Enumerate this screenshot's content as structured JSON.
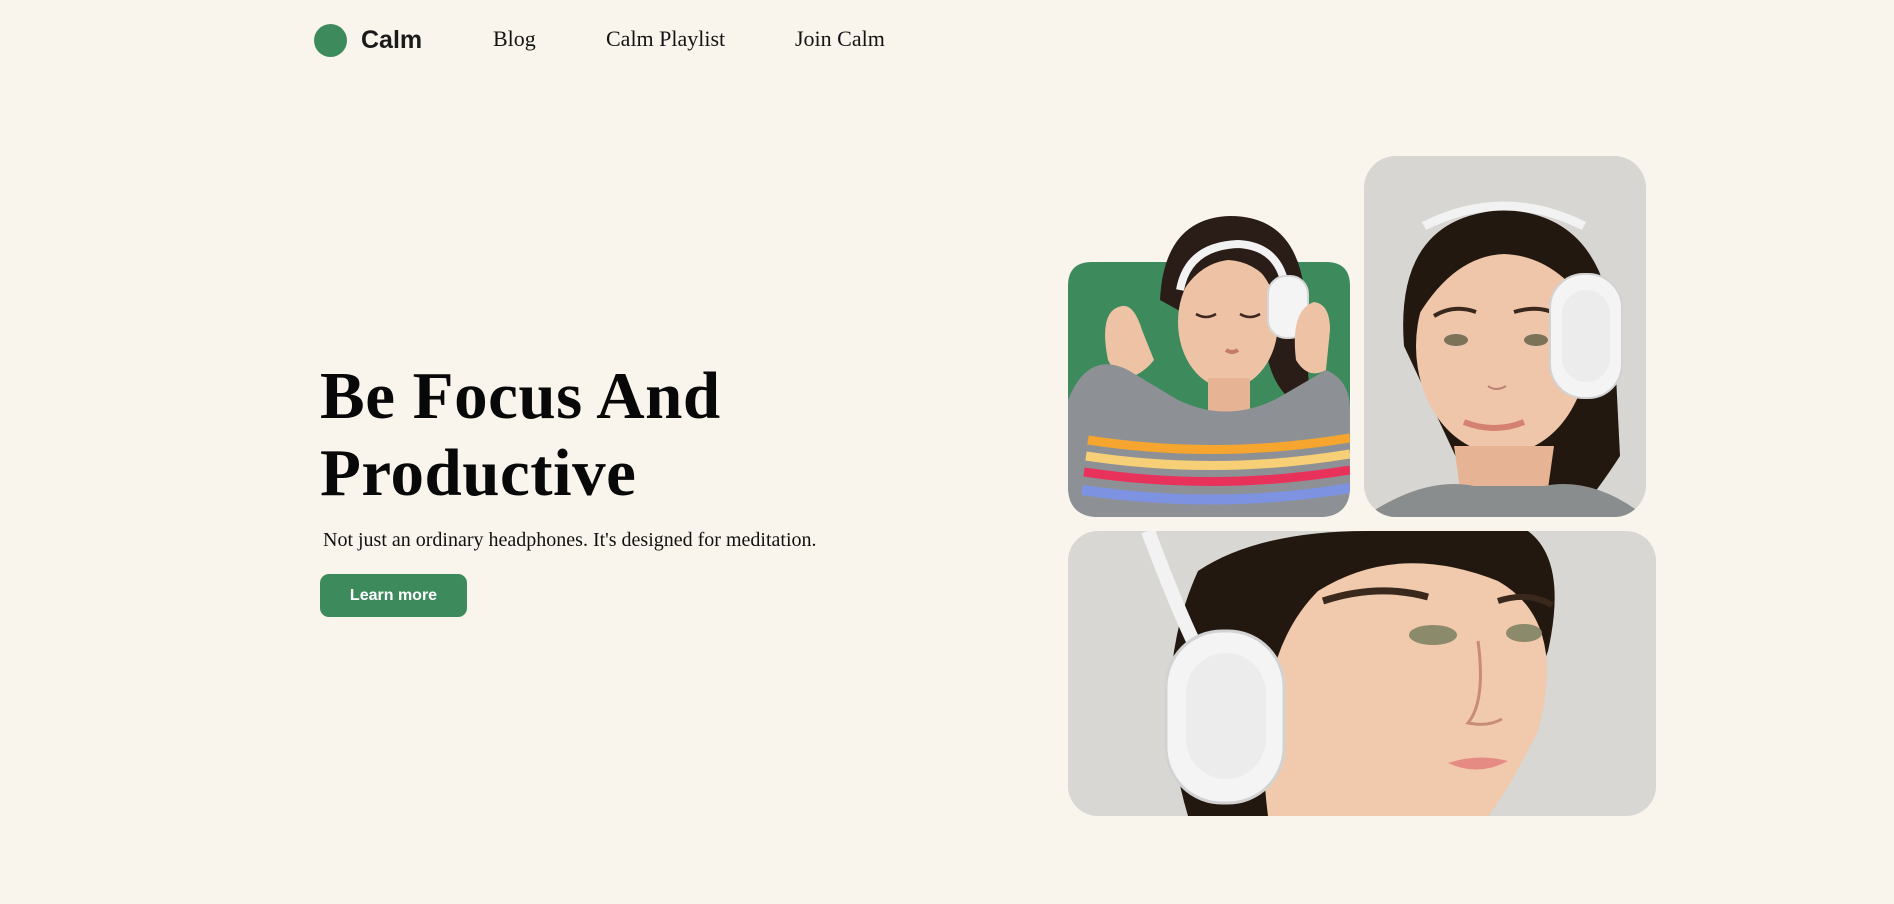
{
  "brand": {
    "name": "Calm",
    "accent_color": "#3d8a5c",
    "background_color": "#f9f4ec"
  },
  "nav": {
    "links": [
      {
        "label": "Blog"
      },
      {
        "label": "Calm Playlist"
      },
      {
        "label": "Join Calm"
      }
    ]
  },
  "hero": {
    "title": "Be Focus And Productive",
    "subtitle": "Not just an ordinary headphones. It's designed for meditation.",
    "cta_label": "Learn more"
  },
  "gallery": {
    "images": [
      {
        "alt": "Woman with closed eyes adjusting white headphones on green background, wearing striped grey sweater"
      },
      {
        "alt": "Woman smiling wearing white headphones on light grey background"
      },
      {
        "alt": "Close-up of woman's face in profile wearing white headphones"
      }
    ]
  }
}
